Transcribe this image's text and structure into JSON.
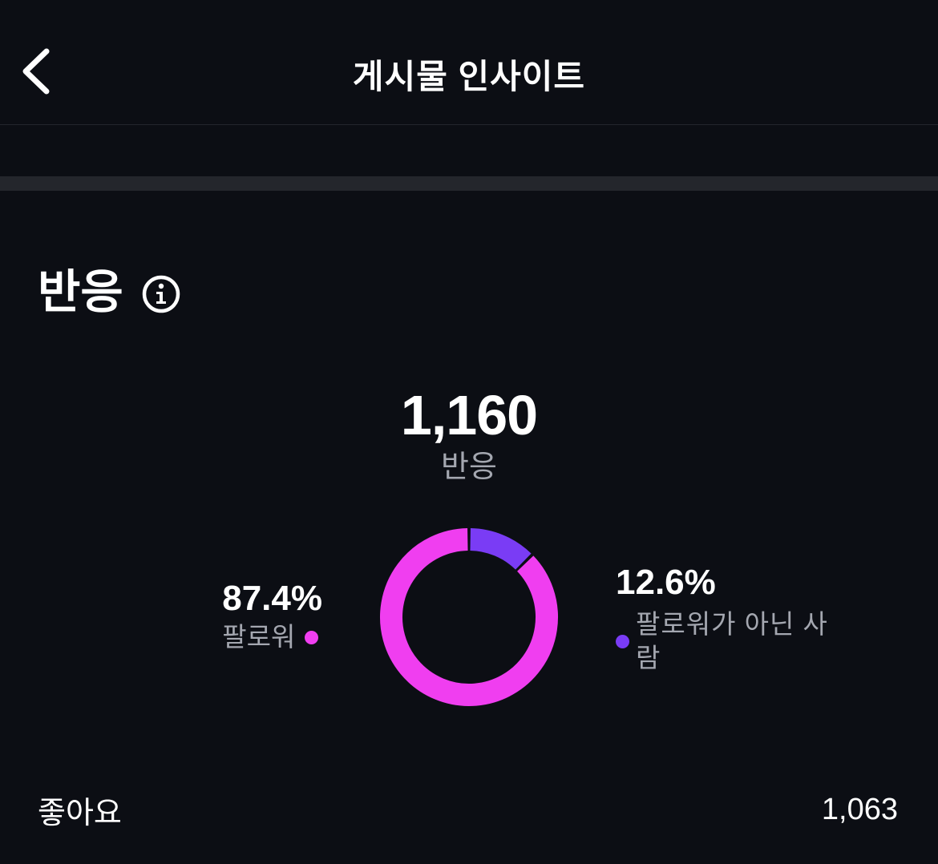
{
  "header": {
    "title": "게시물 인사이트",
    "back_icon": "chevron-left-icon"
  },
  "section": {
    "title": "반응",
    "info_icon": "info-icon"
  },
  "summary": {
    "total_value": "1,160",
    "total_label": "반응"
  },
  "chart_data": {
    "type": "pie",
    "categories": [
      "팔로워",
      "팔로워가 아닌 사람"
    ],
    "values": [
      87.4,
      12.6
    ],
    "labels": [
      "87.4%",
      "12.6%"
    ],
    "colors": [
      "#f03ef0",
      "#7a3cf5"
    ]
  },
  "stats": [
    {
      "label": "좋아요",
      "value": "1,063"
    }
  ]
}
